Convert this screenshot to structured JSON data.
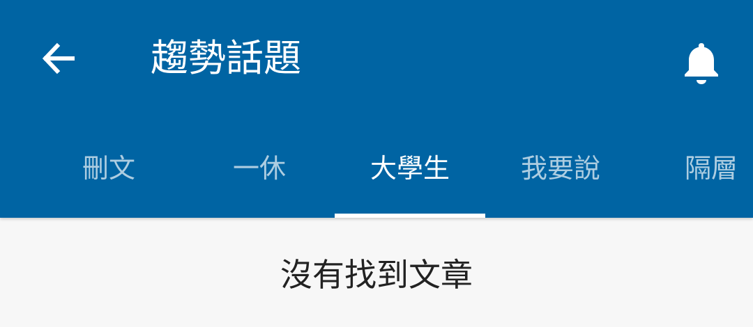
{
  "header": {
    "title": "趨勢話題",
    "back_icon": "arrow-back-icon",
    "bell_icon": "bell-icon",
    "background_color": "#0064a3"
  },
  "tabs": [
    {
      "label": "刪文",
      "active": false
    },
    {
      "label": "一休",
      "active": false
    },
    {
      "label": "大學生",
      "active": true
    },
    {
      "label": "我要說",
      "active": false
    },
    {
      "label": "隔層",
      "active": false
    }
  ],
  "content": {
    "empty_message": "沒有找到文章"
  }
}
